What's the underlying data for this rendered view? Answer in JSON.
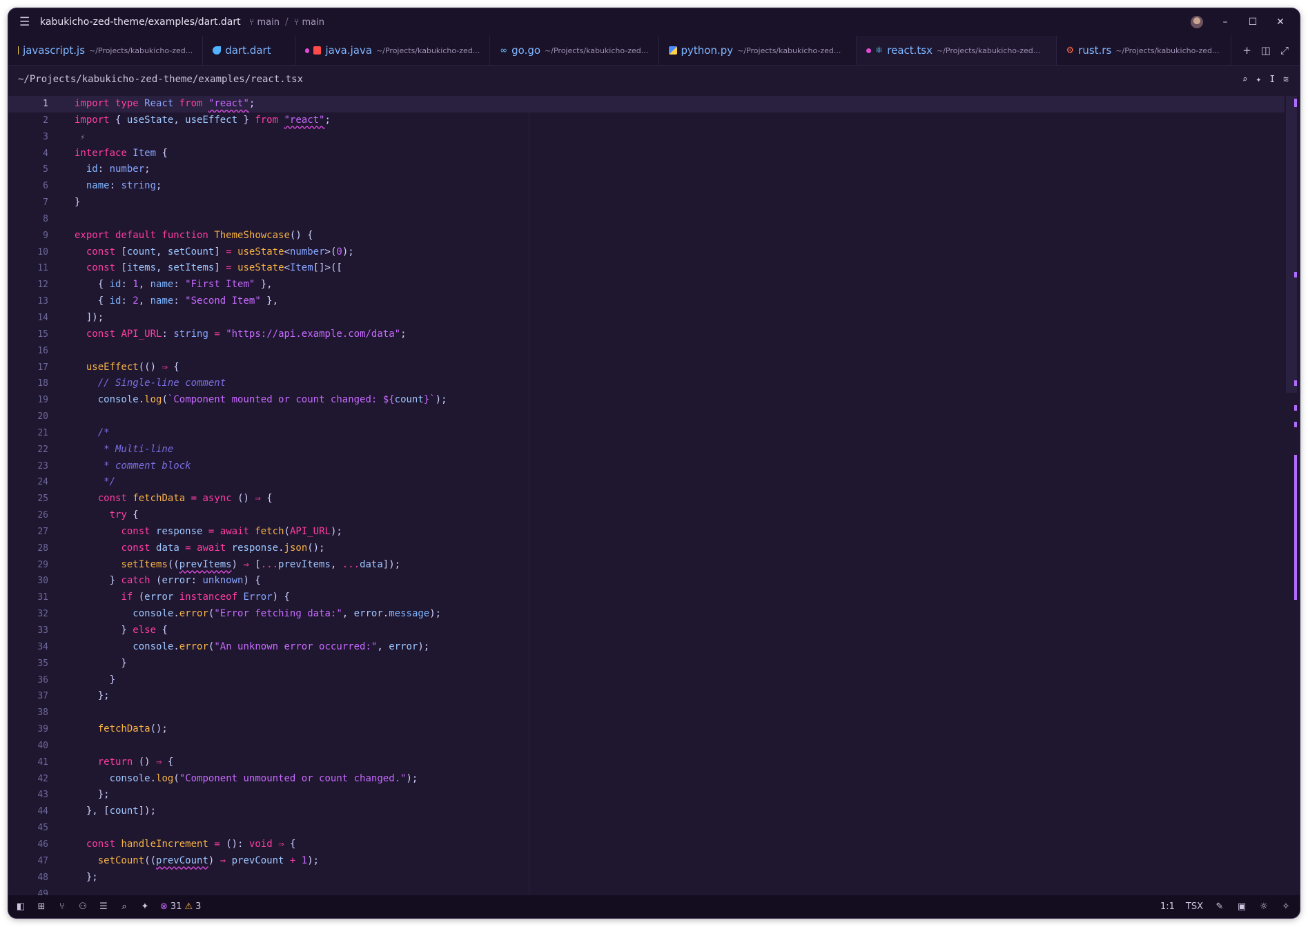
{
  "titlebar": {
    "project": "kabukicho-zed-theme/examples/dart.dart",
    "branch_a": "main",
    "separator": "/",
    "branch_b": "main"
  },
  "tabs": [
    {
      "name": "javascript.js",
      "path": "~/Projects/kabukicho-zed...",
      "icon_color": "#f7d34a",
      "modified": false
    },
    {
      "name": "dart.dart",
      "path": "",
      "icon_color": "#4fb3ff",
      "modified": false
    },
    {
      "name": "java.java",
      "path": "~/Projects/kabukicho-zed...",
      "icon_color": "#ff4a4a",
      "modified": true
    },
    {
      "name": "go.go",
      "path": "~/Projects/kabukicho-zed...",
      "icon_color": "#6ec7ff",
      "modified": false
    },
    {
      "name": "python.py",
      "path": "~/Projects/kabukicho-zed...",
      "icon_color": "#ffd24a",
      "modified": false
    },
    {
      "name": "react.tsx",
      "path": "~/Projects/kabukicho-zed...",
      "icon_color": "#61dafb",
      "modified": true
    },
    {
      "name": "rust.rs",
      "path": "~/Projects/kabukicho-zed...",
      "icon_color": "#ff6a4a",
      "modified": false
    }
  ],
  "breadcrumb": "~/Projects/kabukicho-zed-theme/examples/react.tsx",
  "status": {
    "errors": "31",
    "warnings": "3",
    "cursor": "1:1",
    "language": "TSX"
  }
}
